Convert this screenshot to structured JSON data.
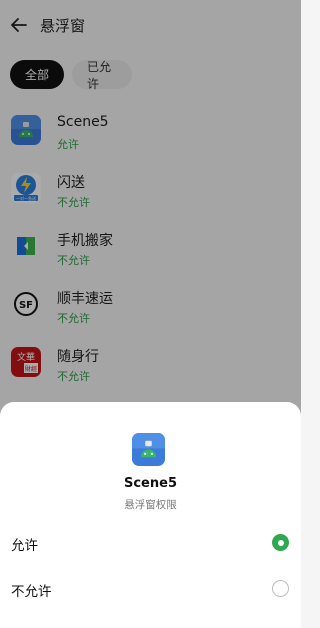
{
  "header": {
    "title": "悬浮窗"
  },
  "filters": {
    "all": "全部",
    "allowed": "已允许"
  },
  "apps": [
    {
      "name": "Scene5",
      "status": "允许"
    },
    {
      "name": "闪送",
      "status": "不允许"
    },
    {
      "name": "手机搬家",
      "status": "不允许"
    },
    {
      "name": "顺丰速运",
      "status": "不允许"
    },
    {
      "name": "随身行",
      "status": "不允许"
    }
  ],
  "icons": {
    "shansong_caption": "一对一急送",
    "sf_logo": "SF",
    "suishenxing_line1": "文華",
    "suishenxing_line2": "財經"
  },
  "sheet": {
    "app_name": "Scene5",
    "subtitle": "悬浮窗权限",
    "options": [
      {
        "label": "允许",
        "selected": true
      },
      {
        "label": "不允许",
        "selected": false
      }
    ]
  },
  "colors": {
    "accent": "#2fa84f",
    "status_text": "#2e9e48"
  }
}
